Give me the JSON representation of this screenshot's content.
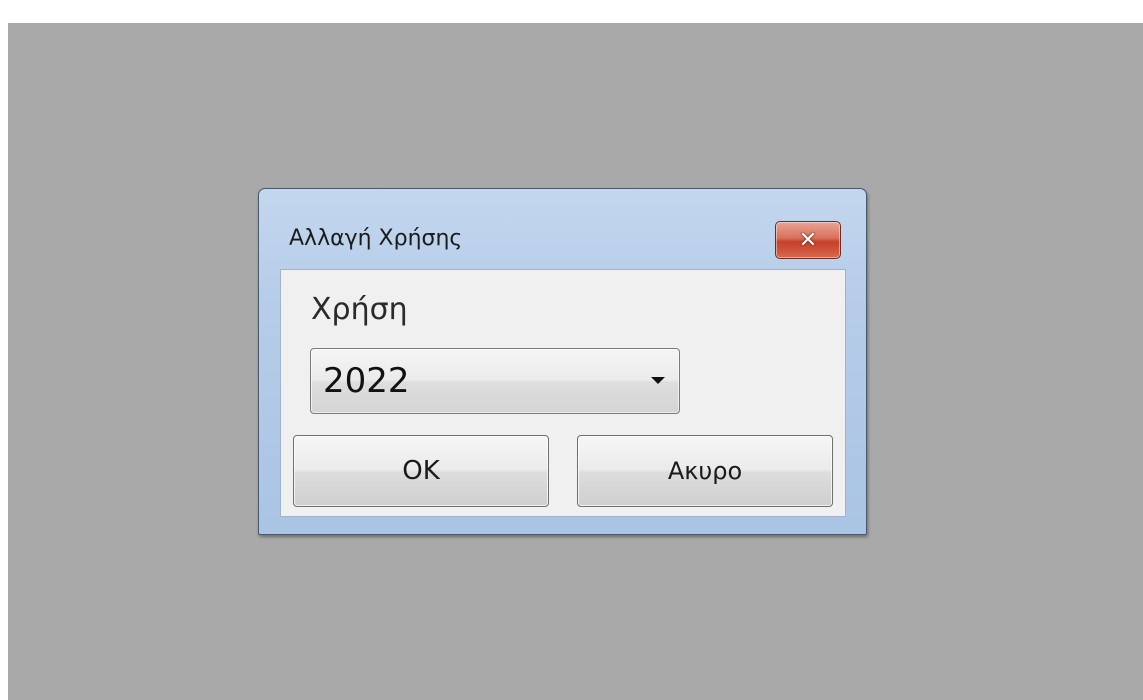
{
  "dialog": {
    "title": "Αλλαγή Χρήσης",
    "close_glyph": "✕",
    "field_label": "Χρήση",
    "year_select": {
      "selected": "2022"
    },
    "buttons": {
      "ok": "OK",
      "cancel": "Ακυρο"
    }
  },
  "colors": {
    "desktop_background": "#a9a9a9",
    "close_button": "#c64027",
    "titlebar": "#b7cde9"
  },
  "icons": {
    "close": "close-icon",
    "dropdown": "chevron-down-icon"
  }
}
